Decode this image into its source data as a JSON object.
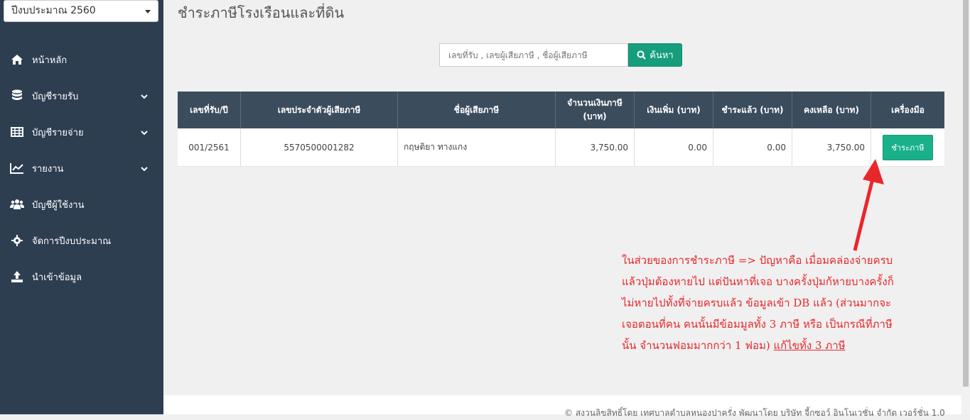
{
  "sidebar": {
    "year_select": "ปีงบประมาณ 2560",
    "items": [
      {
        "label": "หน้าหลัก",
        "icon": "home-icon"
      },
      {
        "label": "บัญชีรายรับ",
        "icon": "database-icon"
      },
      {
        "label": "บัญชีรายจ่าย",
        "icon": "table-icon"
      },
      {
        "label": "รายงาน",
        "icon": "line-chart-icon"
      },
      {
        "label": "บัญชีผู้ใช้งาน",
        "icon": "users-icon"
      },
      {
        "label": "จัดการปีงบประมาณ",
        "icon": "gear-icon"
      },
      {
        "label": "นำเข้าข้อมูล",
        "icon": "upload-icon"
      }
    ]
  },
  "main": {
    "title": "ชำระภาษีโรงเรือนและที่ดิน",
    "search": {
      "placeholder": "เลขที่รับ , เลขผู้เสียภาษี , ชื่อผู้เสียภาษี",
      "button": "ค้นหา"
    },
    "table": {
      "headers": [
        "เลขที่รับ/ปี",
        "เลขประจำตัวผู้เสียภาษี",
        "ชื่อผู้เสียภาษี",
        "จำนวนเงินภาษี (บาท)",
        "เงินเพิ่ม (บาท)",
        "ชำระแล้ว (บาท)",
        "คงเหลือ (บาท)",
        "เครื่องมือ"
      ],
      "rows": [
        {
          "receipt": "001/2561",
          "tax_id": "5570500001282",
          "name": "กฤษติยา ทางแกง",
          "amount": "3,750.00",
          "surcharge": "0.00",
          "paid": "0.00",
          "balance": "3,750.00",
          "action": "ชำระภาษี"
        }
      ]
    },
    "annotation": {
      "text": "ในส่วยของการชำระภาษี => ปัญหาคือ เมื่อมคล่องจ่ายครบแล้วปุ่มต้องหายไป แต่ปันหาที่เจอ บางครั้งปุ่มก้หายบางครั้งก็ไม่หายไปทั้งที่จ่ายครบแล้ว ข้อมูลเข้า DB แล้ว (ส่วนมากจะเจอตอนที่คน คนนั้นมีข้อมมูลทั้ง 3 ภาษี หรือ เป็นกรณีที่ภาษีนั้น จำนวนฟอมมากกว่า 1 ฟอม)",
      "underlined": "แก้ไขทั้ง 3 ภาษี"
    },
    "footer": "© สงวนลิขสิทธิ์โดย เทศบาลตำบลหนองปาครั่ง พัฒนาโดย บริษัท จี้กซอว์ อินโนเวชั่น จำกัด เวอร์ชั่น 1.0"
  },
  "colors": {
    "sidebar_bg": "#2d3e50",
    "table_header_bg": "#3b4c5d",
    "accent_green": "#1ab08a",
    "annotation_red": "#e8272b"
  }
}
